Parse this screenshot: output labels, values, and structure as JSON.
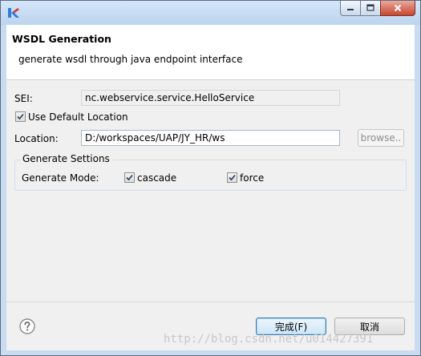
{
  "dialog": {
    "title": "WSDL Generation",
    "description": "generate wsdl through java endpoint interface"
  },
  "form": {
    "sei_label": "SEI:",
    "sei_value": "nc.webservice.service.HelloService",
    "use_default_location_label": "Use Default Location",
    "use_default_location_checked": true,
    "location_label": "Location:",
    "location_value": "D:/workspaces/UAP/JY_HR/ws",
    "browse_label": "browse.."
  },
  "generate_settings": {
    "group_title": "Generate Settions",
    "mode_label": "Generate Mode:",
    "cascade_label": "cascade",
    "cascade_checked": true,
    "force_label": "force",
    "force_checked": true
  },
  "footer": {
    "finish_label": "完成(F)",
    "cancel_label": "取消"
  },
  "watermark": "http://blog.csdn.net/u014427391",
  "colors": {
    "titlebar": "#c8dbf0",
    "accent": "#3c7fb1",
    "logo_blue": "#2f7fd6",
    "logo_red": "#d23a3a"
  }
}
